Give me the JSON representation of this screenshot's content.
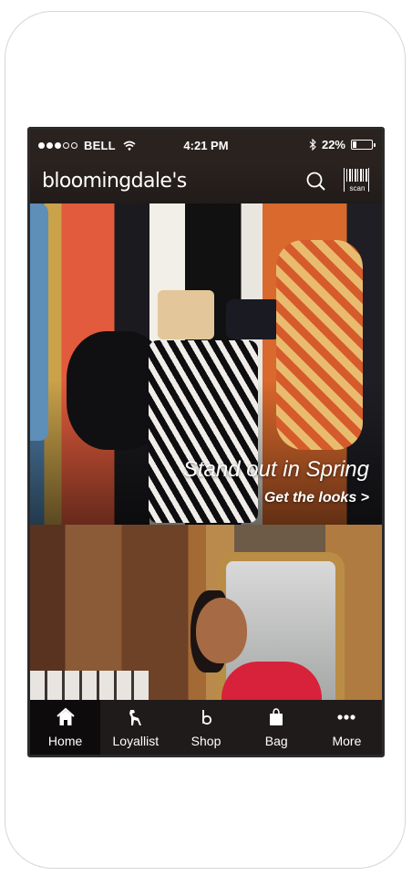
{
  "status_bar": {
    "carrier": "BELL",
    "time": "4:21 PM",
    "battery": "22%",
    "battery_level": 0.22
  },
  "header": {
    "logo": "bloomingdale's",
    "search_icon": "search-icon",
    "scan_label": "scan"
  },
  "hero": {
    "title": "Stand out in Spring",
    "cta": "Get the looks >",
    "pager": {
      "count": 4,
      "active": 0
    }
  },
  "tabbar": {
    "items": [
      {
        "label": "Home",
        "icon": "home-icon",
        "active": true
      },
      {
        "label": "Loyallist",
        "icon": "dog-icon",
        "active": false
      },
      {
        "label": "Shop",
        "icon": "b-logo-icon",
        "active": false
      },
      {
        "label": "Bag",
        "icon": "shopping-bag-icon",
        "active": false
      },
      {
        "label": "More",
        "icon": "more-dots-icon",
        "active": false
      }
    ]
  }
}
